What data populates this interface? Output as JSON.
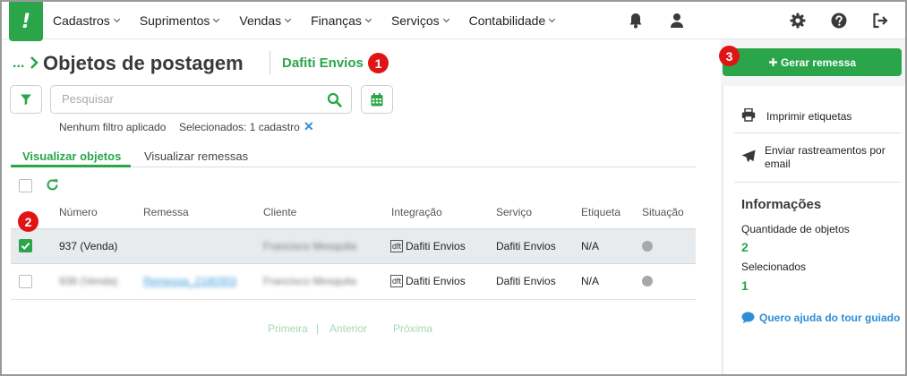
{
  "nav": {
    "logo": "!",
    "menu": [
      "Cadastros",
      "Suprimentos",
      "Vendas",
      "Finanças",
      "Serviços",
      "Contabilidade"
    ]
  },
  "header": {
    "breadcrumb_ellipsis": "...",
    "title": "Objetos de postagem",
    "integration": "Dafiti Envios"
  },
  "badges": [
    "1",
    "2",
    "3"
  ],
  "search": {
    "placeholder": "Pesquisar",
    "value": ""
  },
  "filters": {
    "status": "Nenhum filtro aplicado",
    "selected": "Selecionados: 1 cadastro",
    "clear": "✕"
  },
  "tabs": [
    "Visualizar objetos",
    "Visualizar remessas"
  ],
  "table": {
    "columns": [
      "Número",
      "Remessa",
      "Cliente",
      "Integração",
      "Serviço",
      "Etiqueta",
      "Situação"
    ],
    "rows": [
      {
        "checked": true,
        "numero": "937 (Venda)",
        "remessa": "",
        "cliente": "Francisco Mesquita",
        "integracao_tag": "dft",
        "integracao": "Dafiti Envios",
        "servico": "Dafiti Envios",
        "etiqueta": "N/A"
      },
      {
        "checked": false,
        "numero": "938 (Venda)",
        "remessa": "Remessa_2180303",
        "cliente": "Francisco Mesquita",
        "integracao_tag": "dft",
        "integracao": "Dafiti Envios",
        "servico": "Dafiti Envios",
        "etiqueta": "N/A"
      }
    ]
  },
  "pagination": {
    "first": "Primeira",
    "separator": "|",
    "prev": "Anterior",
    "next": "Próxima"
  },
  "sidebar": {
    "generate_button": "Gerar remessa",
    "actions": [
      "Imprimir etiquetas",
      "Enviar rastreamentos por email"
    ],
    "info_title": "Informações",
    "quantity_label": "Quantidade de objetos",
    "quantity_value": "2",
    "selected_label": "Selecionados",
    "selected_value": "1",
    "help": "Quero ajuda do tour guiado"
  },
  "colors": {
    "primary": "#2aa54a",
    "badge": "#e01414",
    "link": "#2f8ed6"
  }
}
